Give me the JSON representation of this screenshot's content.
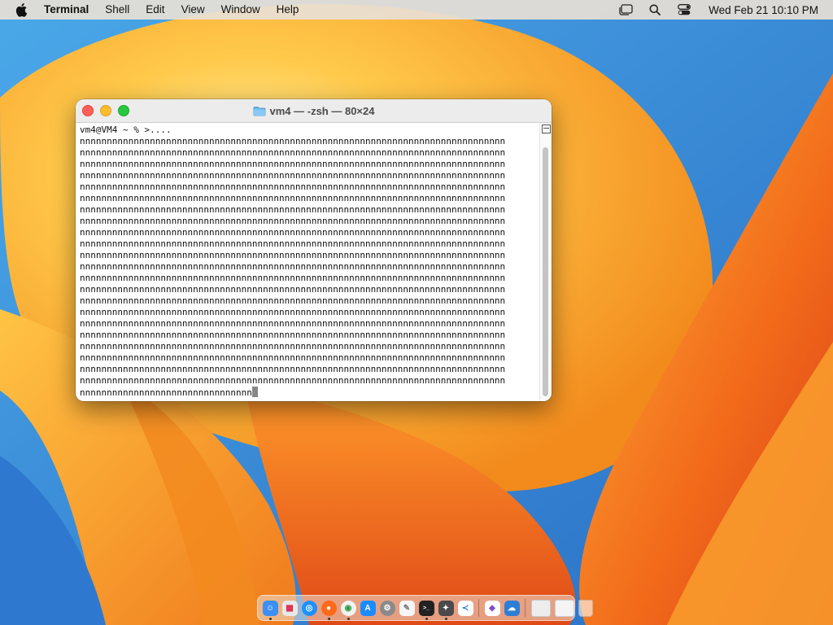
{
  "menubar": {
    "app_name": "Terminal",
    "items": [
      "Shell",
      "Edit",
      "View",
      "Window",
      "Help"
    ],
    "clock": "Wed Feb 21  10:10 PM",
    "icons": [
      "apple-icon",
      "stage-manager-icon",
      "spotlight-search-icon",
      "control-center-icon"
    ]
  },
  "window": {
    "title": "vm4 — -zsh — 80×24",
    "prompt_line": "vm4@VM4 ~ % >....",
    "filled_line": "nnnnnnnnnnnnnnnnnnnnnnnnnnnnnnnnnnnnnnnnnnnnnnnnnnnnnnnnnnnnnnnnnnnnnnnnnnnnnnn",
    "filled_line_count": 22,
    "last_line": "nnnnnnnnnnnnnnnnnnnnnnnnnnnnnnnn"
  },
  "dock": {
    "apps": [
      {
        "name": "finder-icon",
        "color": "#3b8ff5",
        "running": true
      },
      {
        "name": "launchpad-icon",
        "color": "#e8e8e8",
        "running": false
      },
      {
        "name": "safari-icon",
        "color": "#1e90ff",
        "running": false
      },
      {
        "name": "firefox-icon",
        "color": "#ff6a1a",
        "running": true
      },
      {
        "name": "chrome-icon",
        "color": "#f2f2f2",
        "running": true
      },
      {
        "name": "app-store-icon",
        "color": "#1a8cff",
        "running": false
      },
      {
        "name": "system-settings-icon",
        "color": "#8a8a8a",
        "running": false
      },
      {
        "name": "textedit-icon",
        "color": "#f5f5f5",
        "running": false
      },
      {
        "name": "terminal-icon",
        "color": "#222222",
        "running": true
      },
      {
        "name": "xcode-instruments-icon",
        "color": "#4a4a4a",
        "running": true
      },
      {
        "name": "vscode-icon",
        "color": "#ffffff",
        "running": false
      },
      {
        "name": "visual-studio-icon",
        "color": "#ffffff",
        "running": false
      },
      {
        "name": "cloud-drive-icon",
        "color": "#2d7fd6",
        "running": false
      }
    ],
    "extras": [
      "downloads-stack-icon",
      "folder-stack-icon",
      "trash-icon"
    ]
  }
}
